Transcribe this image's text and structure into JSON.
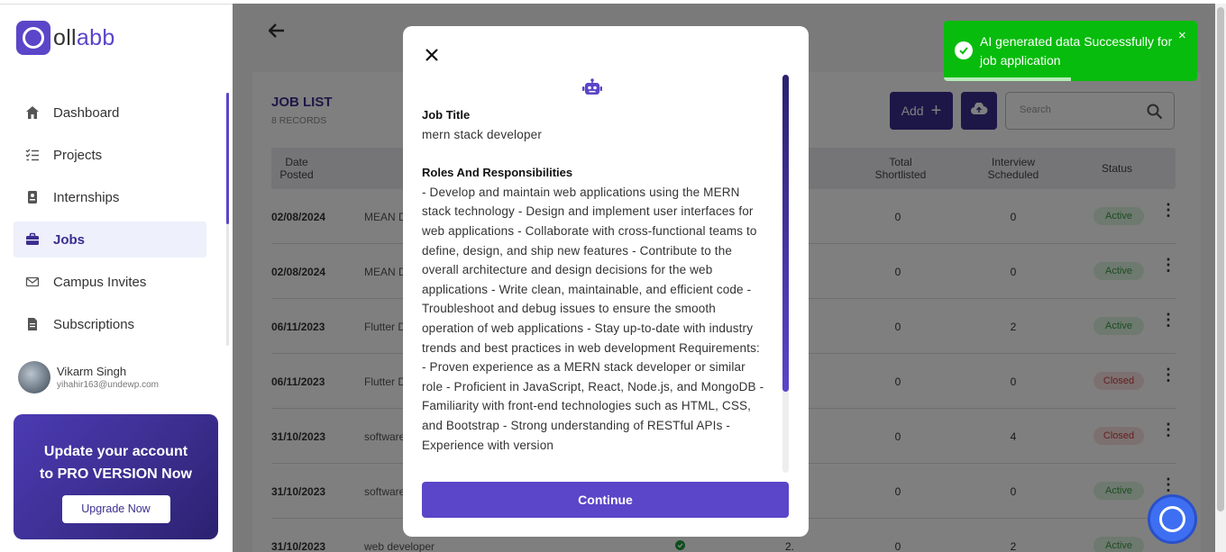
{
  "brand": {
    "name_prefix": "Q",
    "name_mid": "oll",
    "name_suffix": "abb",
    "color": "#5b45c9"
  },
  "sidebar": {
    "items": [
      {
        "label": "Dashboard",
        "icon": "home-icon"
      },
      {
        "label": "Projects",
        "icon": "checklist-icon"
      },
      {
        "label": "Internships",
        "icon": "id-card-icon"
      },
      {
        "label": "Jobs",
        "icon": "briefcase-icon",
        "active": true
      },
      {
        "label": "Campus Invites",
        "icon": "mail-icon"
      },
      {
        "label": "Subscriptions",
        "icon": "document-icon"
      }
    ]
  },
  "user": {
    "name": "Vikarm Singh",
    "email": "yihahir163@undewp.com"
  },
  "promo": {
    "line1": "Update your account",
    "line2": "to PRO VERSION Now",
    "button": "Upgrade Now"
  },
  "main": {
    "title": "JOB LIST",
    "records": "8 RECORDS",
    "add_label": "Add",
    "search_placeholder": "Search",
    "headers": {
      "date_line1": "Date",
      "date_line2": "Posted",
      "shortlisted_line1": "Total",
      "shortlisted_line2": "Shortlisted",
      "interview_line1": "Interview",
      "interview_line2": "Scheduled",
      "status": "Status"
    },
    "rows": [
      {
        "date": "02/08/2024",
        "title": "MEAN D",
        "shortlisted": "0",
        "interview": "0",
        "status": "Active"
      },
      {
        "date": "02/08/2024",
        "title": "MEAN D",
        "shortlisted": "0",
        "interview": "0",
        "status": "Active"
      },
      {
        "date": "06/11/2023",
        "title": "Flutter D",
        "shortlisted": "0",
        "interview": "2",
        "status": "Active"
      },
      {
        "date": "06/11/2023",
        "title": "Flutter D",
        "shortlisted": "0",
        "interview": "0",
        "status": "Closed"
      },
      {
        "date": "31/10/2023",
        "title": "software",
        "shortlisted": "0",
        "interview": "4",
        "status": "Closed"
      },
      {
        "date": "31/10/2023",
        "title": "software",
        "shortlisted": "0",
        "interview": "0",
        "status": "Active"
      },
      {
        "date": "31/10/2023",
        "title": "web developer",
        "applicants": "2.",
        "shortlisted": "0",
        "interview": "2",
        "status": "Active"
      }
    ]
  },
  "modal": {
    "job_title_label": "Job Title",
    "job_title_value": "mern stack developer",
    "roles_label": "Roles And Responsibilities",
    "roles_value": "- Develop and maintain web applications using the MERN stack technology - Design and implement user interfaces for web applications - Collaborate with cross-functional teams to define, design, and ship new features - Contribute to the overall architecture and design decisions for the web applications - Write clean, maintainable, and efficient code - Troubleshoot and debug issues to ensure the smooth operation of web applications - Stay up-to-date with industry trends and best practices in web development Requirements: - Proven experience as a MERN stack developer or similar role - Proficient in JavaScript, React, Node.js, and MongoDB - Familiarity with front-end technologies such as HTML, CSS, and Bootstrap - Strong understanding of RESTful APIs - Experience with version",
    "continue_label": "Continue"
  },
  "toast": {
    "message": "AI generated data Successfully for job application",
    "close": "×",
    "progress": 0.5
  }
}
